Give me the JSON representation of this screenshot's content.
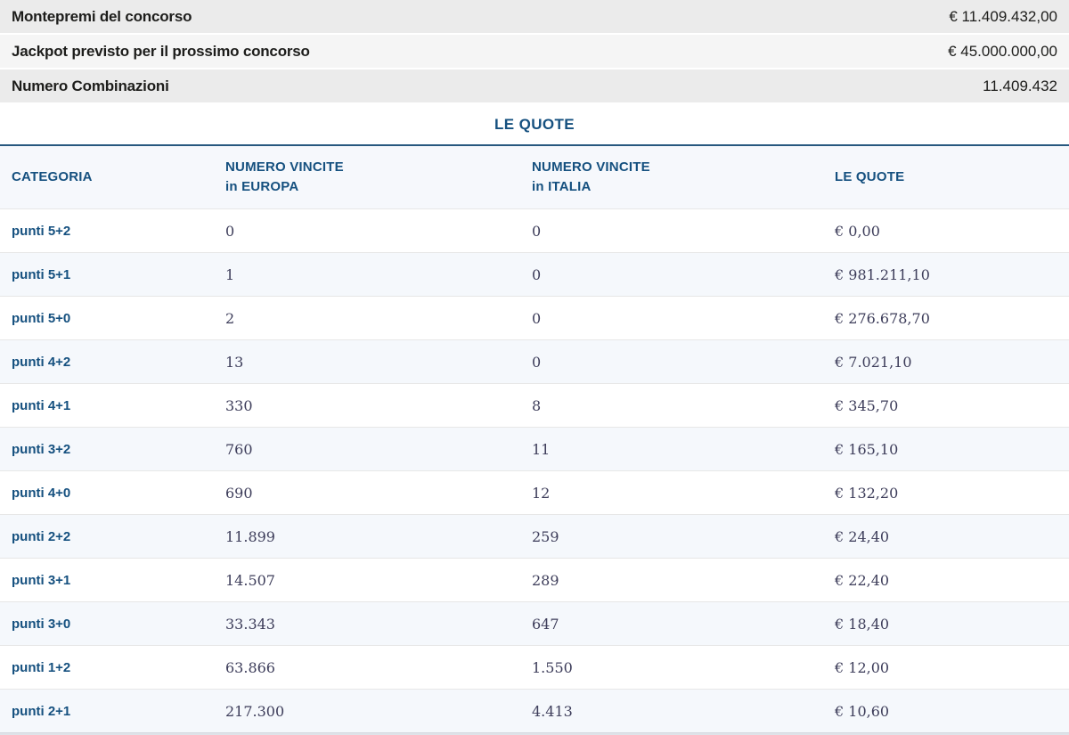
{
  "summary": {
    "rows": [
      {
        "label": "Montepremi del concorso",
        "value": "€ 11.409.432,00"
      },
      {
        "label": "Jackpot previsto per il prossimo concorso",
        "value": "€ 45.000.000,00"
      },
      {
        "label": "Numero Combinazioni",
        "value": "11.409.432"
      }
    ]
  },
  "quote_section": {
    "title": "LE QUOTE",
    "columns": [
      {
        "line1": "CATEGORIA",
        "line2": ""
      },
      {
        "line1": "NUMERO VINCITE",
        "line2": "in EUROPA"
      },
      {
        "line1": "NUMERO VINCITE",
        "line2": "in ITALIA"
      },
      {
        "line1": "LE QUOTE",
        "line2": ""
      }
    ],
    "rows": [
      {
        "categoria": "punti 5+2",
        "europa": "0",
        "italia": "0",
        "quota": "€ 0,00"
      },
      {
        "categoria": "punti 5+1",
        "europa": "1",
        "italia": "0",
        "quota": "€ 981.211,10"
      },
      {
        "categoria": "punti 5+0",
        "europa": "2",
        "italia": "0",
        "quota": "€ 276.678,70"
      },
      {
        "categoria": "punti 4+2",
        "europa": "13",
        "italia": "0",
        "quota": "€ 7.021,10"
      },
      {
        "categoria": "punti 4+1",
        "europa": "330",
        "italia": "8",
        "quota": "€ 345,70"
      },
      {
        "categoria": "punti 3+2",
        "europa": "760",
        "italia": "11",
        "quota": "€ 165,10"
      },
      {
        "categoria": "punti 4+0",
        "europa": "690",
        "italia": "12",
        "quota": "€ 132,20"
      },
      {
        "categoria": "punti 2+2",
        "europa": "11.899",
        "italia": "259",
        "quota": "€ 24,40"
      },
      {
        "categoria": "punti 3+1",
        "europa": "14.507",
        "italia": "289",
        "quota": "€ 22,40"
      },
      {
        "categoria": "punti 3+0",
        "europa": "33.343",
        "italia": "647",
        "quota": "€ 18,40"
      },
      {
        "categoria": "punti 1+2",
        "europa": "63.866",
        "italia": "1.550",
        "quota": "€ 12,00"
      },
      {
        "categoria": "punti 2+1",
        "europa": "217.300",
        "italia": "4.413",
        "quota": "€ 10,60"
      }
    ]
  },
  "colors": {
    "accent_blue": "#15507f",
    "divider_blue": "#27587f",
    "summary_text": "#1d1d1b",
    "summary_bg_a": "#ebebeb",
    "summary_bg_b": "#f5f5f5",
    "value_text": "#3d3d5a",
    "row_alt_bg": "#f5f8fc",
    "header_bg": "#f6f8fc"
  }
}
